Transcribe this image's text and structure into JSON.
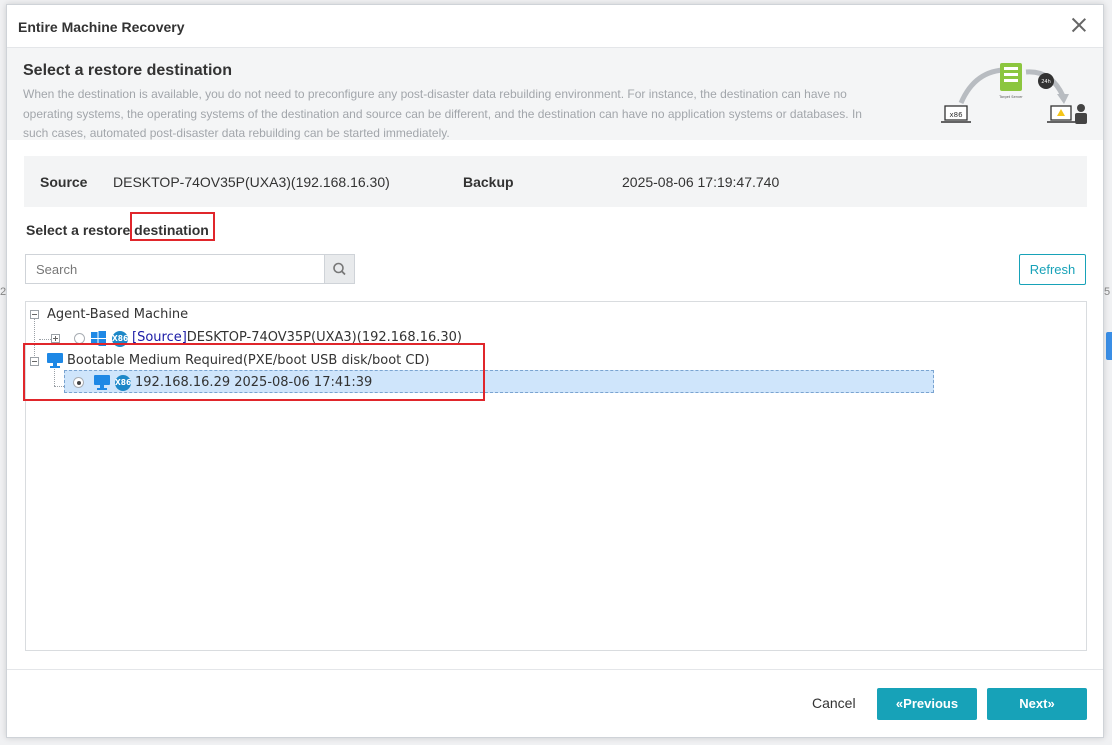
{
  "dialog": {
    "title": "Entire Machine Recovery",
    "step_title": "Select a restore destination",
    "step_description": "When the destination is available, you do not need to preconfigure any post-disaster data rebuilding environment. For instance, the destination can have no operating systems, the operating systems of the destination and source can be different, and the destination can have no application systems or databases. In such cases, automated post-disaster data rebuilding can be started immediately."
  },
  "illustration": {
    "left_label": "x86",
    "badge_24h": "24h",
    "server_caption": "Target Server"
  },
  "info": {
    "source_label": "Source",
    "source_value": "DESKTOP-74OV35P(UXA3)(192.168.16.30)",
    "backup_label": "Backup",
    "backup_value": "2025-08-06 17:19:47.740"
  },
  "destination": {
    "label": "Select a restore destination",
    "search_placeholder": "Search",
    "refresh_label": "Refresh"
  },
  "tree": {
    "agent_group": "Agent-Based Machine",
    "agent_item": {
      "tag": "[Source]",
      "name": "DESKTOP-74OV35P(UXA3)(192.168.16.30)",
      "arch": "X86"
    },
    "bootable_group": "Bootable Medium Required(PXE/boot USB disk/boot CD)",
    "bootable_item": {
      "name": "192.168.16.29 2025-08-06 17:41:39",
      "arch": "X86",
      "selected": true
    }
  },
  "footer": {
    "cancel_label": "Cancel",
    "previous_label": "«Previous",
    "next_label": "Next»"
  },
  "colors": {
    "accent": "#17a2b8",
    "highlight_box": "#e0262b",
    "selection_bg": "#cfe5fb"
  }
}
